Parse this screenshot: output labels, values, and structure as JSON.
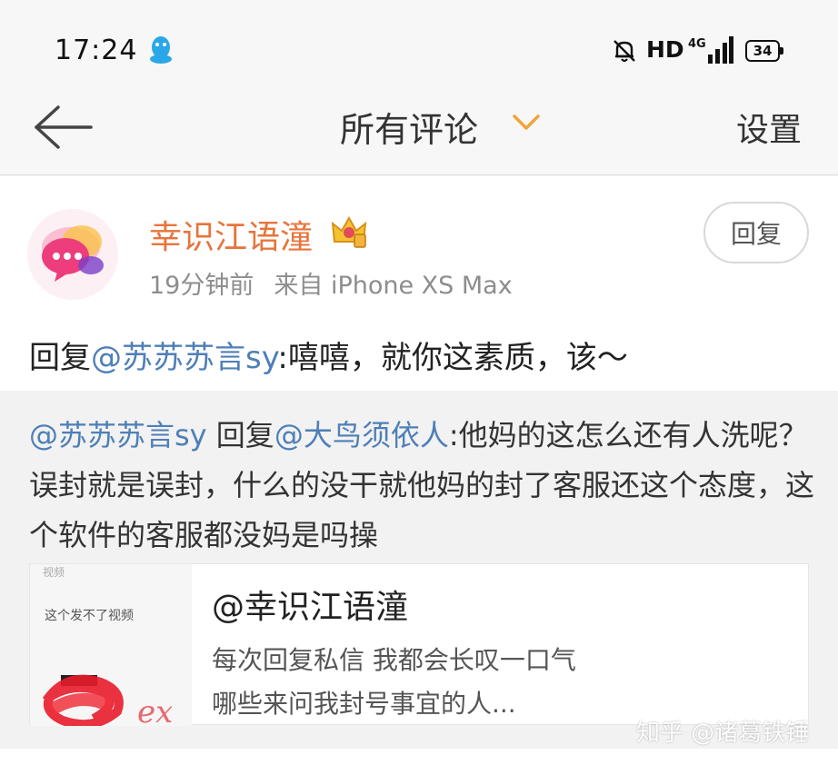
{
  "status_bar": {
    "time": "17:24",
    "hd": "HD",
    "network": "4G",
    "battery": "34"
  },
  "header": {
    "title": "所有评论",
    "settings_label": "设置"
  },
  "comment": {
    "username": "幸识江语潼",
    "time_ago": "19分钟前",
    "source": "来自 iPhone XS Max",
    "reply_label": "回复",
    "text_prefix": "回复",
    "mention": "@苏苏苏言sy",
    "text_body": ":嘻嘻，就你这素质，该～"
  },
  "quoted": {
    "author_mention": "@苏苏苏言sy",
    "reply_word": " 回复",
    "target_mention": "@大鸟须依人",
    "body": ":他妈的这怎么还有人洗呢？误封就是误封，什么的没干就他妈的封了客服还这个态度，这个软件的客服都没妈是吗操",
    "repost": {
      "author": "@幸识江语潼",
      "line1": "每次回复私信 我都会长叹一口气",
      "line2": "哪些来问我封号事宜的人...",
      "thumb_caption": "这个发不了视频",
      "thumb_caption_top": "视频"
    }
  },
  "watermark": "知乎 @诸葛铁锤",
  "colors": {
    "accent_orange": "#e8743a",
    "mention_blue": "#4e7fb8",
    "background": "#f5f5f5"
  }
}
